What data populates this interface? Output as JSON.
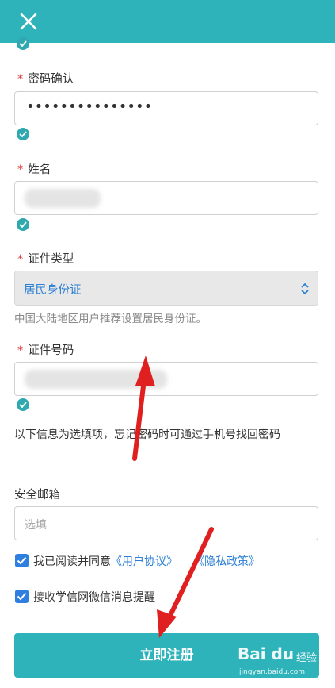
{
  "header": {
    "close_icon": "close-icon",
    "bg_color": "#2fb3bb"
  },
  "form": {
    "confirm_password": {
      "required_mark": "*",
      "label": "密码确认",
      "value": "•••••••••••••••"
    },
    "name": {
      "required_mark": "*",
      "label": "姓名"
    },
    "id_type": {
      "required_mark": "*",
      "label": "证件类型",
      "selected": "居民身份证",
      "hint": "中国大陆地区用户推荐设置居民身份证。"
    },
    "id_number": {
      "required_mark": "*",
      "label": "证件号码"
    },
    "optional_notice": "以下信息为选填项，忘记密码时可通过手机号找回密码",
    "email": {
      "label": "安全邮箱",
      "placeholder": "选填"
    },
    "agreement": {
      "prefix": "我已阅读并同意",
      "user_agreement": "《用户协议》",
      "privacy_policy": "《隐私政策》"
    },
    "wechat_notify": "接收学信网微信消息提醒",
    "submit_label": "立即注册"
  },
  "watermark": {
    "brand": "Bai du",
    "sub": "经验",
    "domain": "jingyan.baidu.com"
  },
  "colors": {
    "accent": "#2fb3bb",
    "check": "#2fa8b0",
    "checkbox": "#2f7fe0",
    "link": "#2a7fd4",
    "arrow": "#e02020",
    "required": "#e23b3b"
  }
}
